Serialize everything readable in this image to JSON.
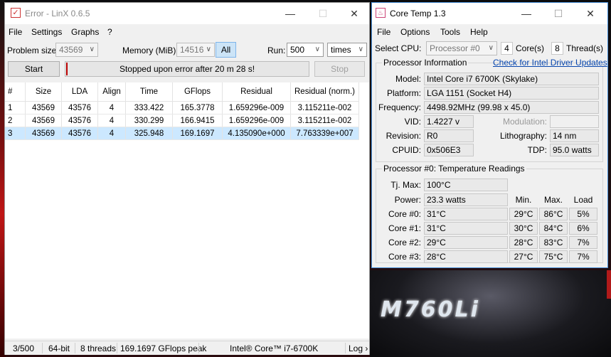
{
  "linx": {
    "title": "Error - LinX 0.6.5",
    "menu": [
      "File",
      "Settings",
      "Graphs",
      "?"
    ],
    "problem_size_label": "Problem size:",
    "problem_size_value": "43569",
    "memory_label": "Memory (MiB):",
    "memory_value": "14516",
    "all_button": "All",
    "run_label": "Run:",
    "run_value": "500",
    "run_unit": "times",
    "start_button": "Start",
    "status_message": "Stopped upon error after 20 m 28 s!",
    "stop_button": "Stop",
    "table": {
      "headers": [
        "#",
        "Size",
        "LDA",
        "Align",
        "Time",
        "GFlops",
        "Residual",
        "Residual (norm.)"
      ],
      "rows": [
        [
          "1",
          "43569",
          "43576",
          "4",
          "333.422",
          "165.3778",
          "1.659296e-009",
          "3.115211e-002"
        ],
        [
          "2",
          "43569",
          "43576",
          "4",
          "330.299",
          "166.9415",
          "1.659296e-009",
          "3.115211e-002"
        ],
        [
          "3",
          "43569",
          "43576",
          "4",
          "325.948",
          "169.1697",
          "4.135090e+000",
          "7.763339e+007"
        ]
      ]
    },
    "statusbar": {
      "progress": "3/500",
      "bits": "64-bit",
      "threads": "8 threads",
      "peak": "169.1697 GFlops peak",
      "cpu": "Intel® Core™ i7-6700K",
      "log": "Log ›"
    }
  },
  "coretemp": {
    "title": "Core Temp 1.3",
    "menu": [
      "File",
      "Options",
      "Tools",
      "Help"
    ],
    "select_cpu_label": "Select CPU:",
    "select_cpu_value": "Processor #0",
    "cores_value": "4",
    "cores_label": "Core(s)",
    "threads_value": "8",
    "threads_label": "Thread(s)",
    "proc_info_title": "Processor Information",
    "driver_link": "Check for Intel Driver Updates",
    "model_label": "Model:",
    "model_value": "Intel Core i7 6700K (Skylake)",
    "platform_label": "Platform:",
    "platform_value": "LGA 1151 (Socket H4)",
    "frequency_label": "Frequency:",
    "frequency_value": "4498.92MHz (99.98 x 45.0)",
    "vid_label": "VID:",
    "vid_value": "1.4227 v",
    "modulation_label": "Modulation:",
    "revision_label": "Revision:",
    "revision_value": "R0",
    "lithography_label": "Lithography:",
    "lithography_value": "14 nm",
    "cpuid_label": "CPUID:",
    "cpuid_value": "0x506E3",
    "tdp_label": "TDP:",
    "tdp_value": "95.0 watts",
    "temps_title": "Processor #0: Temperature Readings",
    "tjmax_label": "Tj. Max:",
    "tjmax_value": "100°C",
    "power_label": "Power:",
    "power_value": "23.3 watts",
    "col_min": "Min.",
    "col_max": "Max.",
    "col_load": "Load",
    "cores": [
      {
        "label": "Core #0:",
        "temp": "31°C",
        "min": "29°C",
        "max": "86°C",
        "load": "5%"
      },
      {
        "label": "Core #1:",
        "temp": "31°C",
        "min": "30°C",
        "max": "84°C",
        "load": "6%"
      },
      {
        "label": "Core #2:",
        "temp": "29°C",
        "min": "28°C",
        "max": "83°C",
        "load": "7%"
      },
      {
        "label": "Core #3:",
        "temp": "28°C",
        "min": "27°C",
        "max": "75°C",
        "load": "7%"
      }
    ]
  },
  "background": {
    "badge": "M760Li"
  }
}
